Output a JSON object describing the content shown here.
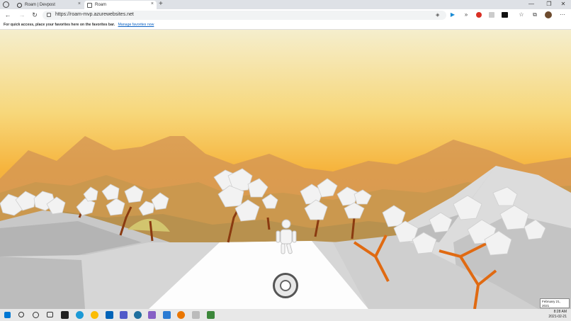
{
  "tabs": [
    {
      "label": "Roam | Devpost",
      "close": "×"
    },
    {
      "label": "Roam",
      "close": "×"
    }
  ],
  "new_tab": "+",
  "window_controls": {
    "minimize": "—",
    "maximize": "❐",
    "close": "✕"
  },
  "nav": {
    "back": "←",
    "forward": "→",
    "refresh": "↻"
  },
  "address": {
    "url": "https://roam-mvp.azurewebsites.net"
  },
  "favorites_bar": {
    "message": "For quick access, place your favorites here on the favorites bar.",
    "link": "Manage favorites now"
  },
  "toolbar_icons": [
    "extensions-icon",
    "media-icon",
    "forward-icon",
    "adblock-icon",
    "extension-icon",
    "imdb-icon",
    "favorites-icon",
    "collections-icon",
    "profile-icon",
    "menu-icon"
  ],
  "colors": {
    "accent": "#0b62c4",
    "sky_top": "#f6e7b0",
    "sky_mid": "#f6b23a",
    "tree_trunk": "#e06a12"
  },
  "taskbar": {
    "apps": [
      "start-icon",
      "search-icon",
      "cortana-icon",
      "task-view-icon",
      "terminal-icon",
      "edge-icon",
      "chrome-icon",
      "outlook-icon",
      "teams-icon",
      "edge-dev-icon",
      "visual-studio-icon",
      "vscode-icon",
      "blender-icon",
      "mail-icon",
      "nodejs-icon"
    ]
  },
  "clock": {
    "time": "8:28 AM",
    "date": "2021-02-21"
  },
  "date_tooltip": {
    "line1": "February 21, 2021",
    "line2": "Sunday"
  }
}
